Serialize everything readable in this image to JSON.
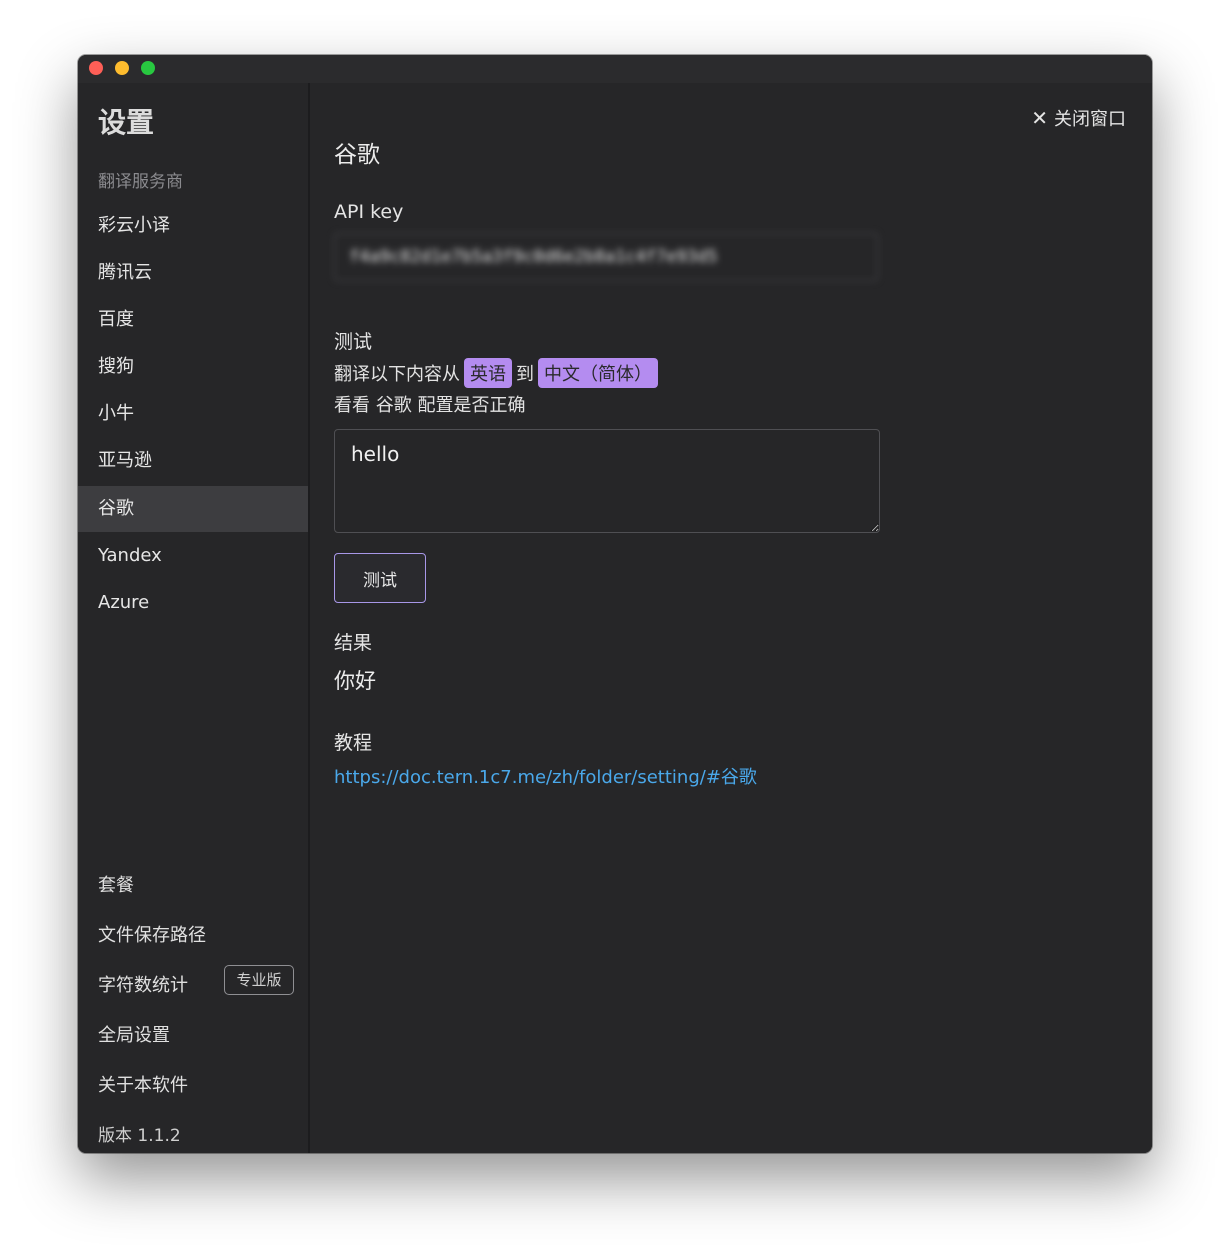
{
  "window": {
    "traffic_lights": [
      "close",
      "minimize",
      "zoom"
    ]
  },
  "sidebar": {
    "title": "设置",
    "section_label": "翻译服务商",
    "items": [
      {
        "label": "彩云小译",
        "active": false
      },
      {
        "label": "腾讯云",
        "active": false
      },
      {
        "label": "百度",
        "active": false
      },
      {
        "label": "搜狗",
        "active": false
      },
      {
        "label": "小牛",
        "active": false
      },
      {
        "label": "亚马逊",
        "active": false
      },
      {
        "label": "谷歌",
        "active": true
      },
      {
        "label": "Yandex",
        "active": false
      },
      {
        "label": "Azure",
        "active": false
      }
    ],
    "bottom_items": [
      {
        "label": "套餐"
      },
      {
        "label": "文件保存路径"
      },
      {
        "label": "字符数统计",
        "badge": "专业版"
      },
      {
        "label": "全局设置"
      },
      {
        "label": "关于本软件"
      }
    ],
    "version": "版本 1.1.2"
  },
  "main": {
    "close_label": "关闭窗口",
    "provider_title": "谷歌",
    "api_key_label": "API key",
    "api_key_value": "f4a9c82d1e7b5a3f9c0d6e2b8a1c4f7e93d5",
    "test_heading": "测试",
    "test_desc": {
      "prefix": "翻译以下内容从",
      "source_lang": "英语",
      "connector": "到",
      "target_lang": "中文（简体）"
    },
    "test_desc_line2": "看看 谷歌 配置是否正确",
    "test_input": "hello",
    "test_button": "测试",
    "result_label": "结果",
    "result_value": "你好",
    "tutorial_label": "教程",
    "tutorial_link": "https://doc.tern.1c7.me/zh/folder/setting/#谷歌"
  },
  "colors": {
    "background": "#262628",
    "accent_purple": "#b48cf0",
    "link_blue": "#4aa8ea",
    "active_item": "#3d3d40"
  }
}
